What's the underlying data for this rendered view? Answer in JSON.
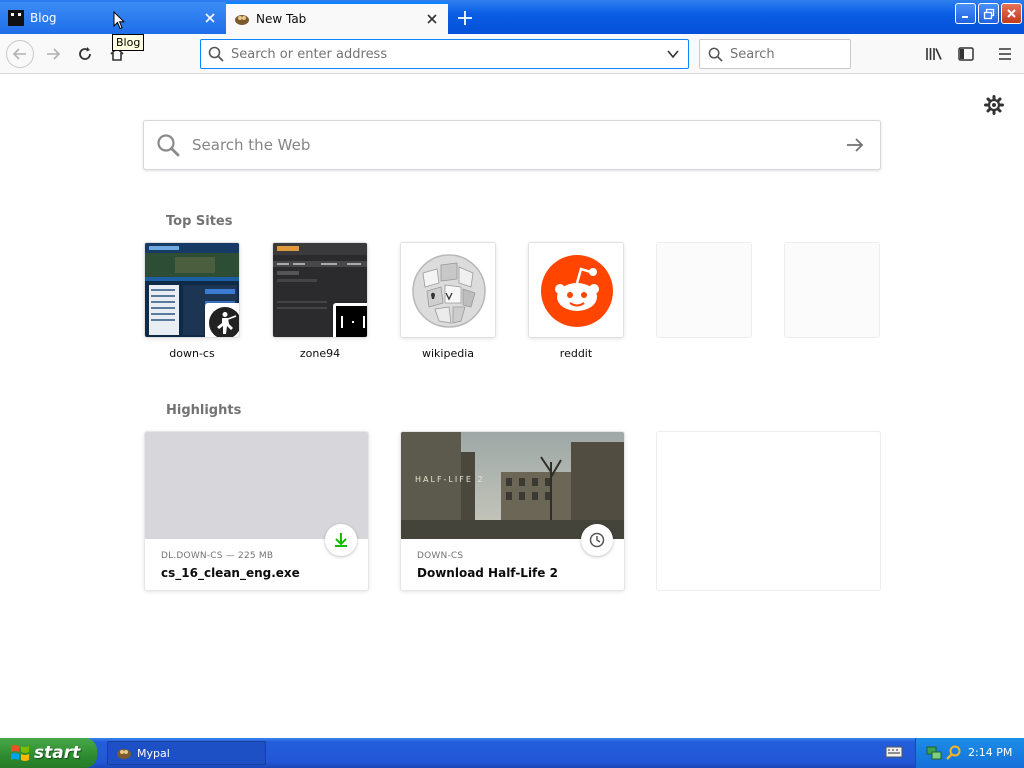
{
  "tabs": [
    {
      "label": "Blog",
      "active": false
    },
    {
      "label": "New Tab",
      "active": true
    }
  ],
  "tooltip": "Blog",
  "urlbar": {
    "placeholder": "Search or enter address",
    "value": ""
  },
  "searchbar": {
    "placeholder": "Search"
  },
  "web_search": {
    "placeholder": "Search the Web"
  },
  "top_sites": {
    "title": "Top Sites",
    "items": [
      {
        "label": "down-cs"
      },
      {
        "label": "zone94"
      },
      {
        "label": "wikipedia"
      },
      {
        "label": "reddit"
      },
      {
        "label": ""
      },
      {
        "label": ""
      }
    ]
  },
  "highlights": {
    "title": "Highlights",
    "items": [
      {
        "source": "DL.DOWN-CS — 225 MB",
        "title": "cs_16_clean_eng.exe",
        "icon": "download-icon"
      },
      {
        "source": "DOWN-CS",
        "title": "Download Half-Life 2",
        "icon": "clock-icon"
      }
    ]
  },
  "taskbar": {
    "start_label": "start",
    "task_label": "Mypal",
    "clock": "2:14 PM"
  },
  "colors": {
    "accent": "#0a84ff",
    "reddit": "#ff4500",
    "download": "#12bc00"
  }
}
